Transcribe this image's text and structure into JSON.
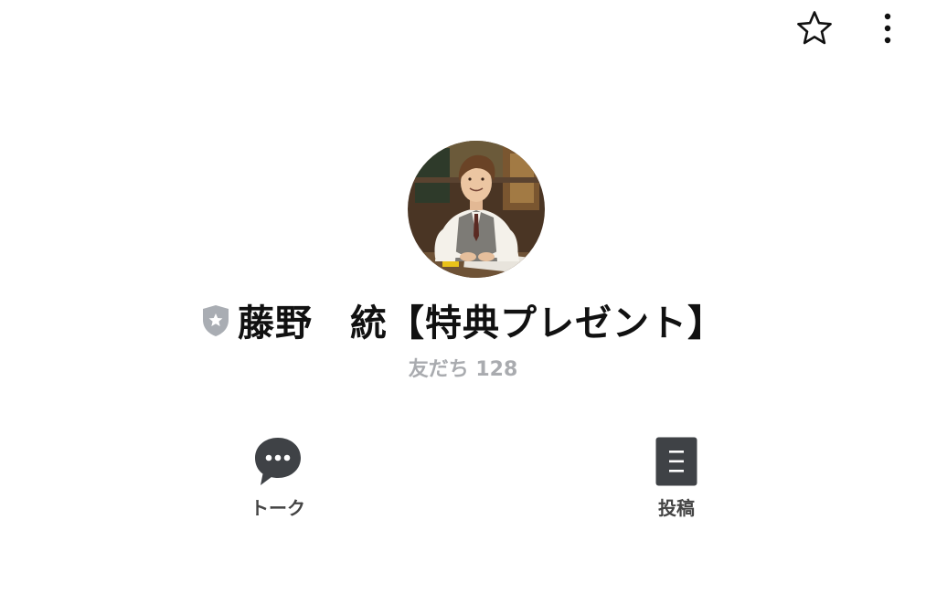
{
  "header": {
    "favorite_icon": "star-outline-icon",
    "more_icon": "vertical-dots-icon"
  },
  "profile": {
    "avatar": "profile-photo",
    "badge_icon": "shield-star-icon",
    "badge_color": "#a9adb3",
    "name": "藤野　統【特典プレゼント】",
    "friends_text": "友だち 128"
  },
  "actions": [
    {
      "label": "トーク",
      "icon": "chat-bubble-icon"
    },
    {
      "label": "投稿",
      "icon": "document-icon"
    }
  ]
}
